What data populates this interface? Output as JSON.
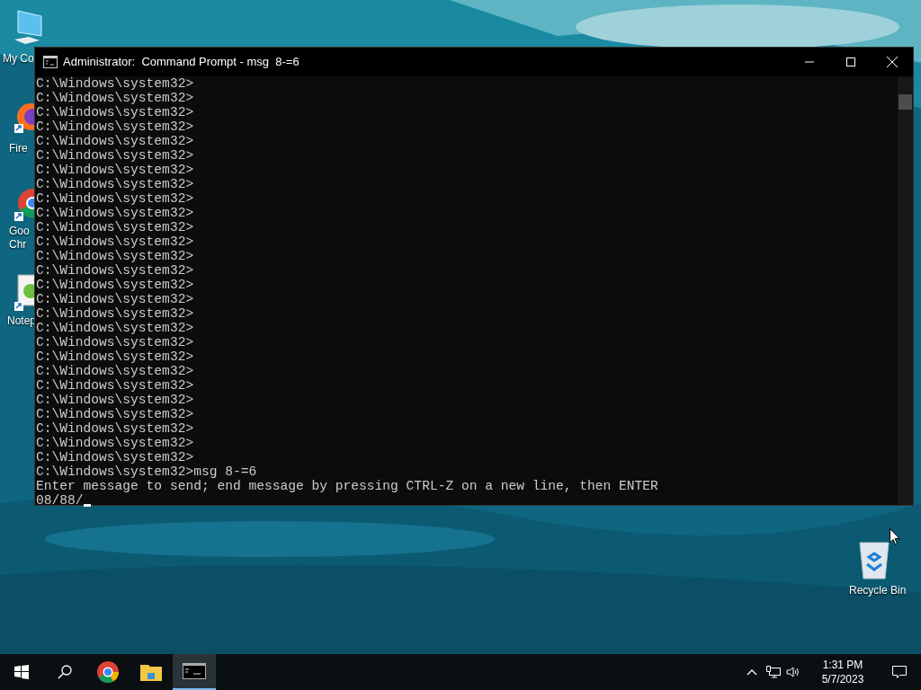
{
  "desktop_icons": [
    {
      "kind": "computer",
      "label": [
        "My Co"
      ]
    },
    {
      "kind": "firefox",
      "label": [
        "Fire"
      ]
    },
    {
      "kind": "chrome",
      "label": [
        "Goo",
        "Chr"
      ]
    },
    {
      "kind": "notepad",
      "label": [
        "Notep"
      ]
    },
    {
      "kind": "recycle",
      "label": [
        "Recycle Bin"
      ]
    }
  ],
  "window": {
    "title": "Administrator:  Command Prompt - msg  8-=6",
    "lines": [
      "C:\\Windows\\system32>",
      "C:\\Windows\\system32>",
      "C:\\Windows\\system32>",
      "C:\\Windows\\system32>",
      "C:\\Windows\\system32>",
      "C:\\Windows\\system32>",
      "C:\\Windows\\system32>",
      "C:\\Windows\\system32>",
      "C:\\Windows\\system32>",
      "C:\\Windows\\system32>",
      "C:\\Windows\\system32>",
      "C:\\Windows\\system32>",
      "C:\\Windows\\system32>",
      "C:\\Windows\\system32>",
      "C:\\Windows\\system32>",
      "C:\\Windows\\system32>",
      "C:\\Windows\\system32>",
      "C:\\Windows\\system32>",
      "C:\\Windows\\system32>",
      "C:\\Windows\\system32>",
      "C:\\Windows\\system32>",
      "C:\\Windows\\system32>",
      "C:\\Windows\\system32>",
      "C:\\Windows\\system32>",
      "C:\\Windows\\system32>",
      "C:\\Windows\\system32>",
      "C:\\Windows\\system32>",
      "C:\\Windows\\system32>msg 8-=6",
      "Enter message to send; end message by pressing CTRL-Z on a new line, then ENTER"
    ],
    "input": "08/88/"
  },
  "taskbar": {
    "apps": [
      {
        "kind": "start",
        "selected": false
      },
      {
        "kind": "search",
        "selected": false
      },
      {
        "kind": "chrome",
        "selected": false
      },
      {
        "kind": "explorer",
        "selected": false
      },
      {
        "kind": "console",
        "selected": true
      }
    ],
    "time": "1:31 PM",
    "date": "5/7/2023"
  }
}
